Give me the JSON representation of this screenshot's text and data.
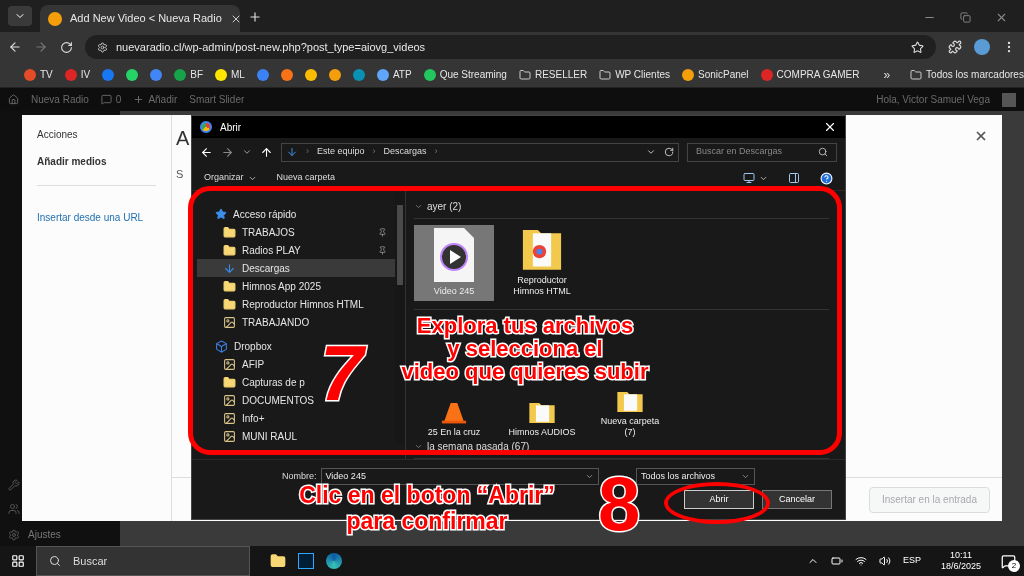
{
  "browser": {
    "tabs": [
      {
        "title": "Add New Video < Nueva Radio",
        "selected": true
      }
    ],
    "url": "nuevaradio.cl/wp-admin/post-new.php?post_type=aiovg_videos",
    "bookmarks": [
      {
        "kind": "link",
        "label": "TV",
        "color": "#e34c26"
      },
      {
        "kind": "link",
        "label": "IV",
        "color": "#dc2626"
      },
      {
        "kind": "icon",
        "color": "#1877f2"
      },
      {
        "kind": "icon",
        "color": "#25d366"
      },
      {
        "kind": "icon",
        "color": "#4285f4"
      },
      {
        "kind": "link",
        "label": "BF",
        "color": "#16a34a"
      },
      {
        "kind": "link",
        "label": "ML",
        "color": "#ffe600"
      },
      {
        "kind": "icon",
        "color": "#3b82f6"
      },
      {
        "kind": "icon",
        "color": "#f97316"
      },
      {
        "kind": "icon",
        "color": "#fbbc04"
      },
      {
        "kind": "icon",
        "color": "#f59e0b"
      },
      {
        "kind": "icon",
        "color": "#0891b2"
      },
      {
        "kind": "link",
        "label": "ATP",
        "color": "#60a5fa"
      },
      {
        "kind": "link",
        "label": "Que Streaming",
        "color": "#22c55e"
      },
      {
        "kind": "folder",
        "label": "RESELLER"
      },
      {
        "kind": "folder",
        "label": "WP Clientes"
      },
      {
        "kind": "link",
        "label": "SonicPanel",
        "color": "#f59e0b"
      },
      {
        "kind": "link",
        "label": "COMPRA GAMER",
        "color": "#dc2626"
      }
    ],
    "more": "»",
    "all_bookmarks": "Todos los marcadores"
  },
  "admin_bar": {
    "site": "Nueva Radio",
    "comments": "0",
    "new": "Añadir",
    "plugin": "Smart Slider",
    "greeting": "Hola, Victor Samuel Vega"
  },
  "sidebar": {
    "bottom_item": "Ajustes"
  },
  "media_modal": {
    "menu": [
      {
        "label": "Acciones",
        "kind": "item"
      },
      {
        "label": "Añadir medios",
        "kind": "item"
      },
      {
        "label": "Insertar desde una URL",
        "kind": "link"
      }
    ],
    "title": "A",
    "tab": "S",
    "insert_button": {
      "label": "Insertar en la entrada",
      "disabled": true
    }
  },
  "dialog": {
    "title": "Abrir",
    "breadcrumb": [
      "Este equipo",
      "Descargas"
    ],
    "breadcrumb_separator": "›",
    "search": {
      "placeholder": "Buscar en Descargas"
    },
    "toolbar": {
      "organize": "Organizar",
      "new_folder": "Nueva carpeta"
    },
    "tree": [
      {
        "label": "Acceso rápido",
        "kind": "star",
        "selected": false,
        "children": [
          {
            "label": "TRABAJOS",
            "kind": "folder",
            "pinned": true,
            "selected": false
          },
          {
            "label": "Radios PLAY",
            "kind": "folder",
            "pinned": true,
            "selected": false
          },
          {
            "label": "Descargas",
            "kind": "download",
            "pinned": false,
            "selected": true
          },
          {
            "label": "Himnos App 2025",
            "kind": "folder",
            "pinned": false,
            "selected": false
          },
          {
            "label": "Reproductor Himnos HTML",
            "kind": "folder",
            "pinned": false,
            "selected": false
          },
          {
            "label": "TRABAJANDO",
            "kind": "shared",
            "pinned": false,
            "selected": false
          }
        ]
      },
      {
        "label": "Dropbox",
        "kind": "dropbox",
        "selected": false,
        "children": [
          {
            "label": "AFIP",
            "kind": "shared",
            "pinned": false,
            "selected": false
          },
          {
            "label": "Capturas de p",
            "kind": "folder",
            "pinned": false,
            "selected": false
          },
          {
            "label": "DOCUMENTOS",
            "kind": "shared",
            "pinned": false,
            "selected": false
          },
          {
            "label": "Info+",
            "kind": "shared",
            "pinned": false,
            "selected": false
          },
          {
            "label": "MUNI RAUL",
            "kind": "shared",
            "pinned": false,
            "selected": false
          }
        ]
      }
    ],
    "groups": [
      {
        "header": "ayer (2)",
        "items": [
          {
            "name": "Video 245",
            "kind": "video",
            "selected": true
          },
          {
            "name": "Reproductor Himnos HTML",
            "kind": "chrome-folder",
            "selected": false
          }
        ]
      },
      {
        "items": [
          {
            "name": "25 En la cruz",
            "kind": "vlc",
            "selected": false
          },
          {
            "name": "Himnos AUDIOS",
            "kind": "folder",
            "selected": false
          },
          {
            "name": "Nueva carpeta (7)",
            "kind": "folder",
            "selected": false
          }
        ]
      },
      {
        "header": "la semana pasada (67)"
      }
    ],
    "filename_label": "Nombre:",
    "filename": "Video 245",
    "filter": "Todos los archivos",
    "open_button": "Abrir",
    "cancel_button": "Cancelar"
  },
  "annotations": {
    "step_one": "7",
    "step_one_lines": [
      "Explora tus archivos",
      "y selecciona el",
      "video que quieres subir"
    ],
    "step_two": "8",
    "step_two_lines": [
      "Clic en el boton “Abrir”",
      "para confirmar"
    ]
  },
  "taskbar": {
    "search": {
      "placeholder": "Buscar"
    },
    "language": "ESP",
    "time": "10:11",
    "date": "18/6/2025",
    "notifications": "2"
  }
}
